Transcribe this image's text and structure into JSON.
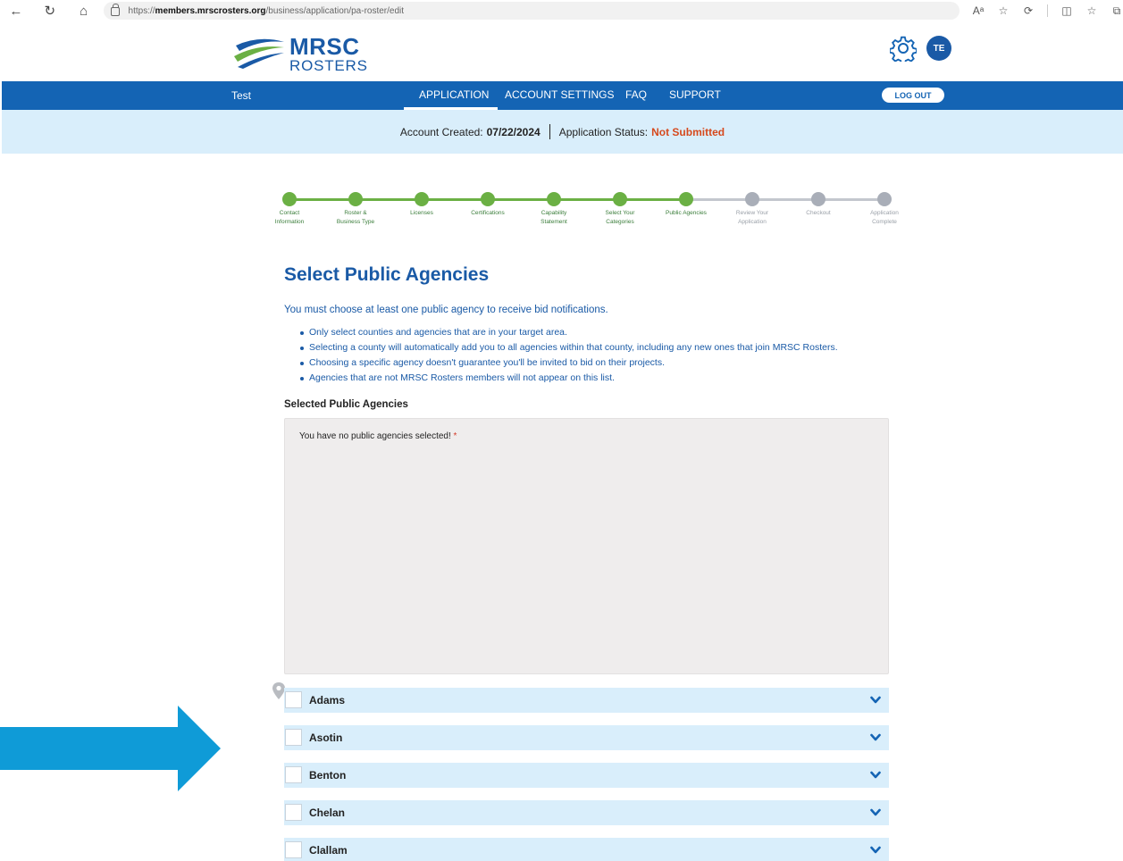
{
  "browser": {
    "url_prefix": "https://",
    "url_host": "members.mrscrosters.org",
    "url_path": "/business/application/pa-roster/edit"
  },
  "header": {
    "logo_line1": "MRSC",
    "logo_line2": "ROSTERS",
    "avatar_initials": "TE"
  },
  "nav": {
    "user": "Test",
    "items": [
      "APPLICATION",
      "ACCOUNT SETTINGS",
      "FAQ",
      "SUPPORT"
    ],
    "logout": "LOG OUT"
  },
  "status": {
    "created_label": "Account Created:",
    "created_value": "07/22/2024",
    "app_status_label": "Application Status:",
    "app_status_value": "Not Submitted"
  },
  "steps": [
    {
      "label": "Contact\nInformation",
      "complete": true
    },
    {
      "label": "Roster &\nBusiness Type",
      "complete": true
    },
    {
      "label": "Licenses",
      "complete": true
    },
    {
      "label": "Certifications",
      "complete": true
    },
    {
      "label": "Capability\nStatement",
      "complete": true
    },
    {
      "label": "Select Your\nCategories",
      "complete": true
    },
    {
      "label": "Public Agencies",
      "complete": true
    },
    {
      "label": "Review Your\nApplication",
      "complete": false
    },
    {
      "label": "Checkout",
      "complete": false
    },
    {
      "label": "Application\nComplete",
      "complete": false
    }
  ],
  "main": {
    "title": "Select Public Agencies",
    "intro": "You must choose at least one public agency to receive bid notifications.",
    "bullets": [
      "Only select counties and agencies that are in your target area.",
      "Selecting a county will automatically add you to all agencies within that county, including any new ones that join MRSC Rosters.",
      "Choosing a specific agency doesn't guarantee you'll be invited to bid on their projects.",
      "Agencies that are not MRSC Rosters members will not appear on this list."
    ],
    "selected_label": "Selected Public Agencies",
    "empty_text": "You have no public agencies selected!",
    "required_mark": "*"
  },
  "counties": [
    "Adams",
    "Asotin",
    "Benton",
    "Chelan",
    "Clallam"
  ],
  "colors": {
    "brand_blue": "#1464b4",
    "light_blue": "#d9eefb",
    "step_done": "#6bb044",
    "step_todo": "#a9aeb8",
    "status_alert": "#d64a1e",
    "arrow": "#0f9bd7"
  }
}
